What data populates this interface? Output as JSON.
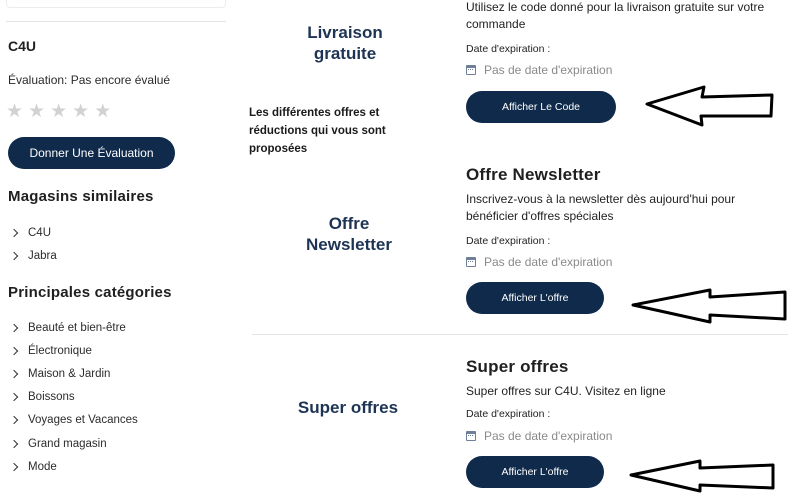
{
  "sidebar": {
    "store_name": "C4U",
    "rating": "Évaluation: Pas encore évalué",
    "stars": [
      "★",
      "★",
      "★",
      "★",
      "★"
    ],
    "rate_button": "Donner Une Évaluation",
    "similar_heading": "Magasins similaires",
    "similar": [
      "C4U",
      "Jabra"
    ],
    "categories_heading": "Principales catégories",
    "categories": [
      "Beauté et bien-être",
      "Électronique",
      "Maison & Jardin",
      "Boissons",
      "Voyages et Vacances",
      "Grand magasin",
      "Mode"
    ]
  },
  "annotations": {
    "livraison": "Livraison gratuite",
    "description": "Les différentes offres et réductions qui vous sont proposées",
    "newsletter": "Offre Newsletter",
    "super": "Super offres"
  },
  "offers": [
    {
      "title": "",
      "description": "Utilisez le code donné pour la livraison gratuite sur votre commande",
      "exp_label": "Date d'expiration :",
      "exp_value": "Pas de date d'expiration",
      "button": "Afficher Le Code"
    },
    {
      "title": "Offre Newsletter",
      "description": "Inscrivez-vous à la newsletter dès aujourd'hui pour bénéficier d'offres spéciales",
      "exp_label": "Date d'expiration :",
      "exp_value": "Pas de date d'expiration",
      "button": "Afficher L'offre"
    },
    {
      "title": "Super offres",
      "description": "Super offres sur C4U. Visitez en ligne",
      "exp_label": "Date d'expiration :",
      "exp_value": "Pas de date d'expiration",
      "button": "Afficher L'offre"
    }
  ],
  "colors": {
    "button_bg": "#0f2a4a",
    "annotation_text": "#1d3454",
    "star_empty": "#d2d2d2"
  },
  "icons": {
    "calendar": "calendar-icon",
    "chevron": "chevron-right-icon",
    "star": "star-icon",
    "arrow": "left-arrow-icon"
  }
}
